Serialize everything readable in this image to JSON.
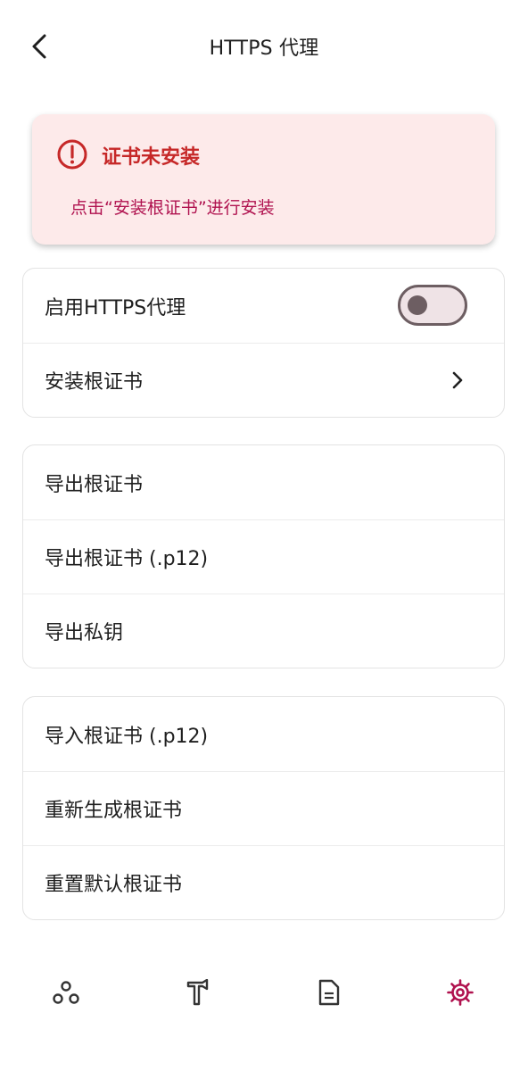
{
  "header": {
    "title": "HTTPS 代理"
  },
  "alert": {
    "title": "证书未安装",
    "message": "点击“安装根证书”进行安装",
    "color": "#c62828"
  },
  "group1": {
    "enable_https_proxy": {
      "label": "启用HTTPS代理",
      "toggled": false
    },
    "install_root_cert": {
      "label": "安装根证书"
    }
  },
  "group2": {
    "export_root_cert": "导出根证书",
    "export_root_cert_p12": "导出根证书 (.p12)",
    "export_private_key": "导出私钥"
  },
  "group3": {
    "import_root_cert_p12": "导入根证书 (.p12)",
    "regenerate_root_cert": "重新生成根证书",
    "reset_default_root_cert": "重置默认根证书"
  },
  "bottom_nav": {
    "items": [
      "network-nodes-icon",
      "tools-hammer-icon",
      "document-icon",
      "settings-gear-icon"
    ],
    "active": "settings-gear-icon",
    "active_color": "#b0124f"
  }
}
